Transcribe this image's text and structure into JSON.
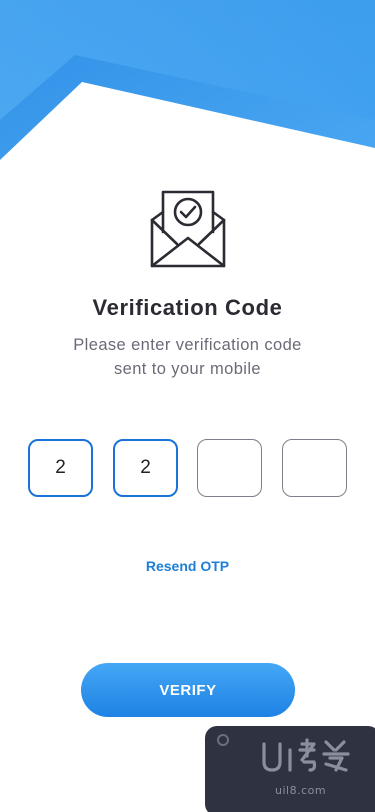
{
  "header": {
    "colors": {
      "primary": "#2a8fe8",
      "light": "#5bb2f7"
    }
  },
  "icon": {
    "name": "mail-check-icon"
  },
  "content": {
    "title": "Verification Code",
    "subtitle_line1": "Please enter verification code",
    "subtitle_line2": "sent to your mobile"
  },
  "otp": {
    "digits": [
      "2",
      "2",
      "",
      ""
    ]
  },
  "resend_label": "Resend OTP",
  "verify_label": "VERIFY",
  "watermark": {
    "logo": "ui老爸",
    "domain": "uil8.com"
  },
  "colors": {
    "accent": "#1d7fd6",
    "filled_border": "#1a73d9",
    "empty_border": "#7c8089"
  }
}
